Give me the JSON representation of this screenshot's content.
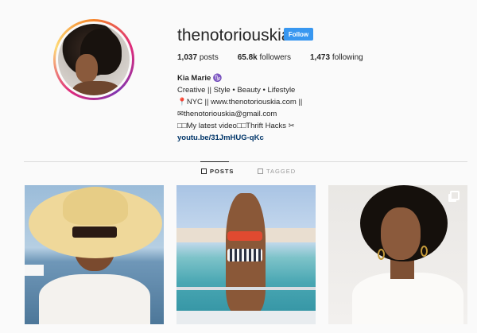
{
  "profile": {
    "username": "thenotoriouskia",
    "follow_label": "Follow",
    "stats": {
      "posts_count": "1,037",
      "posts_label": "posts",
      "followers_count": "65.8k",
      "followers_label": "followers",
      "following_count": "1,473",
      "following_label": "following"
    },
    "bio": {
      "name": "Kia Marie ♑",
      "line1": "Creative || Style • Beauty • Lifestyle",
      "line2": "📍NYC || www.thenotoriouskia.com ||",
      "line3": "✉thenotoriouskia@gmail.com",
      "line4": "□□My latest video□□Thrift Hacks ✂",
      "link": "youtu.be/31JmHUG-qKc"
    }
  },
  "tabs": [
    {
      "label": "POSTS",
      "icon": "grid-icon"
    },
    {
      "label": "TAGGED",
      "icon": "tagged-icon"
    }
  ],
  "colors": {
    "follow_button": "#3897f0",
    "link": "#003569",
    "background": "#fafafa"
  }
}
